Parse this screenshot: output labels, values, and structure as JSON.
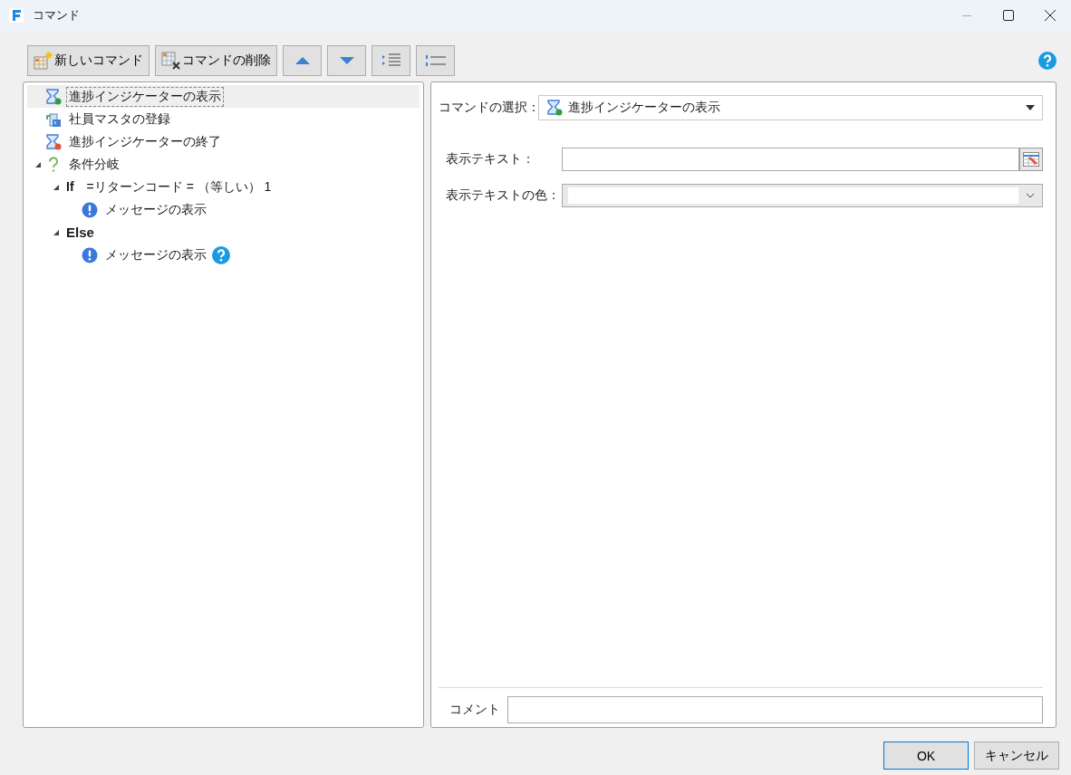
{
  "window": {
    "title": "コマンド"
  },
  "toolbar": [
    {
      "kind": "new",
      "label": "新しいコマンド"
    },
    {
      "kind": "delete",
      "label": "コマンドの削除"
    },
    {
      "kind": "up"
    },
    {
      "kind": "down"
    },
    {
      "kind": "indent"
    },
    {
      "kind": "outdent"
    }
  ],
  "tree": [
    {
      "kind": "progress-show",
      "label": "進捗インジケーターの表示",
      "selected": true
    },
    {
      "kind": "register",
      "label": "社員マスタの登録",
      "selected": false
    },
    {
      "kind": "progress-end",
      "label": "進捗インジケーターの終了",
      "selected": false
    },
    {
      "kind": "condition",
      "label": "条件分岐",
      "selected": false,
      "expanded": true,
      "children": [
        {
          "kind": "if",
          "keyword": "If",
          "label": "=リターンコード = （等しい） 1",
          "selected": false,
          "expanded": true,
          "children": [
            {
              "kind": "message",
              "label": "メッセージの表示",
              "selected": false,
              "help": false
            }
          ]
        },
        {
          "kind": "else",
          "keyword": "Else",
          "selected": false,
          "expanded": true,
          "children": [
            {
              "kind": "message",
              "label": "メッセージの表示",
              "selected": false,
              "help": true
            }
          ]
        }
      ]
    }
  ],
  "editor": {
    "command_select": {
      "label": "コマンドの選択：",
      "value": "進捗インジケーターの表示"
    },
    "fields": [
      {
        "kind": "text",
        "label": "表示テキスト："
      },
      {
        "kind": "color",
        "label": "表示テキストの色："
      }
    ],
    "comment": {
      "label": "コメント"
    }
  },
  "buttons": [
    {
      "label": "OK",
      "default": true
    },
    {
      "label": "キャンセル",
      "default": false
    }
  ]
}
